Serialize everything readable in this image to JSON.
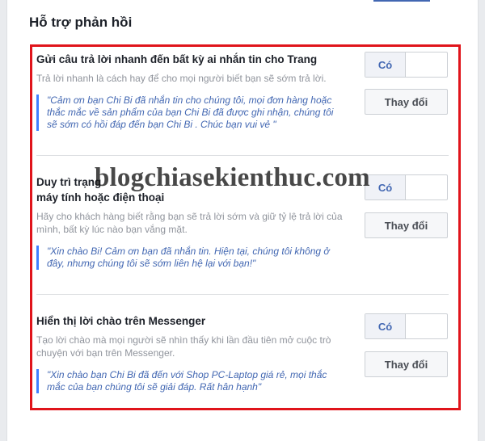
{
  "panel": {
    "title": "Hỗ trợ phản hồi"
  },
  "sections": [
    {
      "title": "Gửi câu trả lời nhanh đến bất kỳ ai nhắn tin cho Trang",
      "description": "Trả lời nhanh là cách hay để cho mọi người biết bạn sẽ sớm trả lời.",
      "quote": "\"Cảm ơn bạn Chi Bi đã nhắn tin cho chúng tôi, mọi đơn hàng hoặc thắc mắc về sản phẩm của bạn Chi Bi đã được ghi nhận, chúng tôi sẽ sớm có hồi đáp đến bạn Chi Bi . Chúc bạn vui vẻ \"",
      "toggle_label": "Có",
      "change_label": "Thay đổi"
    },
    {
      "title": "Duy trì trạng thái ... khi bạn không thể truy cập máy tính hoặc điện thoại",
      "title_visible": "Duy trì trạng",
      "title_line2": "máy tính hoặc điện thoại",
      "description": "Hãy cho khách hàng biết rằng bạn sẽ trả lời sớm và giữ tỷ lệ trả lời của mình, bất kỳ lúc nào bạn vắng mặt.",
      "quote": "\"Xin chào Bi! Cảm ơn bạn đã nhắn tin. Hiện tại, chúng tôi không ở đây, nhưng chúng tôi sẽ sớm liên hệ lại với bạn!\"",
      "toggle_label": "Có",
      "change_label": "Thay đổi"
    },
    {
      "title": "Hiển thị lời chào trên Messenger",
      "description": "Tạo lời chào mà mọi người sẽ nhìn thấy khi lần đầu tiên mở cuộc trò chuyện với bạn trên Messenger.",
      "quote": "\"Xin chào bạn Chi Bi đã đến với Shop PC-Laptop giá rẻ, mọi thắc mắc của bạn chúng tôi sẽ giải đáp. Rất hân hạnh\"",
      "toggle_label": "Có",
      "change_label": "Thay đổi"
    }
  ],
  "watermark": "blogchiasekienthuc.com",
  "colors": {
    "highlight": "#e0141b",
    "link_blue": "#4267b2",
    "quote_bar": "#4080ff"
  }
}
